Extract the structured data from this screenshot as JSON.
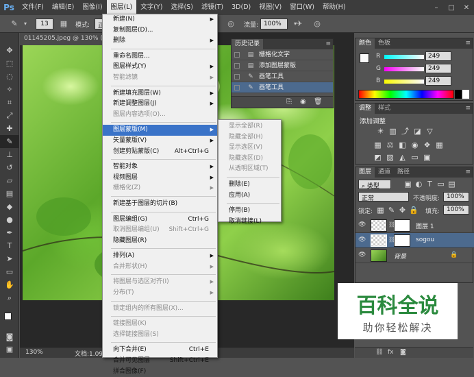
{
  "menubar": {
    "logo": "Ps",
    "items": [
      "文件(F)",
      "编辑(E)",
      "图像(I)",
      "图层(L)",
      "文字(Y)",
      "选择(S)",
      "滤镜(T)",
      "3D(D)",
      "视图(V)",
      "窗口(W)",
      "帮助(H)"
    ],
    "active_index": 3
  },
  "options_bar": {
    "brush_size": "13",
    "mode_label": "模式:",
    "mode_value": "正",
    "flow_label": "流量:",
    "flow_value": "100%"
  },
  "document": {
    "tab_title": "01145205.jpeg @ 130% (sog"
  },
  "status": {
    "zoom": "130%",
    "doc_info": "文档:1.09"
  },
  "layer_menu": {
    "items": [
      {
        "label": "新建(N)",
        "arrow": true
      },
      {
        "label": "复制图层(D)..."
      },
      {
        "label": "删除",
        "arrow": true
      },
      {
        "sep": true
      },
      {
        "label": "重命名图层..."
      },
      {
        "label": "图层样式(Y)",
        "arrow": true
      },
      {
        "label": "智能滤镜",
        "disabled": true,
        "arrow": true
      },
      {
        "sep": true
      },
      {
        "label": "新建填充图层(W)",
        "arrow": true
      },
      {
        "label": "新建调整图层(J)",
        "arrow": true
      },
      {
        "label": "图层内容选项(O)...",
        "disabled": true
      },
      {
        "sep": true
      },
      {
        "label": "图层蒙版(M)",
        "arrow": true,
        "highlighted": true
      },
      {
        "label": "矢量蒙版(V)",
        "arrow": true
      },
      {
        "label": "创建剪贴蒙版(C)",
        "shortcut": "Alt+Ctrl+G"
      },
      {
        "sep": true
      },
      {
        "label": "智能对象",
        "arrow": true
      },
      {
        "label": "视频图层",
        "arrow": true
      },
      {
        "label": "栅格化(Z)",
        "disabled": true,
        "arrow": true
      },
      {
        "sep": true
      },
      {
        "label": "新建基于图层的切片(B)"
      },
      {
        "sep": true
      },
      {
        "label": "图层编组(G)",
        "shortcut": "Ctrl+G"
      },
      {
        "label": "取消图层编组(U)",
        "shortcut": "Shift+Ctrl+G",
        "disabled": true
      },
      {
        "label": "隐藏图层(R)"
      },
      {
        "sep": true
      },
      {
        "label": "排列(A)",
        "arrow": true
      },
      {
        "label": "合并形状(H)",
        "disabled": true,
        "arrow": true
      },
      {
        "sep": true
      },
      {
        "label": "将图层与选区对齐(I)",
        "disabled": true,
        "arrow": true
      },
      {
        "label": "分布(T)",
        "disabled": true,
        "arrow": true
      },
      {
        "sep": true
      },
      {
        "label": "锁定组内的所有图层(X)...",
        "disabled": true
      },
      {
        "sep": true
      },
      {
        "label": "链接图层(K)",
        "disabled": true
      },
      {
        "label": "选择链接图层(S)",
        "disabled": true
      },
      {
        "sep": true
      },
      {
        "label": "向下合并(E)",
        "shortcut": "Ctrl+E"
      },
      {
        "label": "合并可见图层",
        "shortcut": "Shift+Ctrl+E"
      },
      {
        "label": "拼合图像(F)"
      }
    ]
  },
  "mask_submenu": {
    "items": [
      {
        "label": "显示全部(R)",
        "disabled": true
      },
      {
        "label": "隐藏全部(H)",
        "disabled": true
      },
      {
        "label": "显示选区(V)",
        "disabled": true
      },
      {
        "label": "隐藏选区(D)",
        "disabled": true
      },
      {
        "label": "从透明区域(T)",
        "disabled": true
      },
      {
        "sep": true
      },
      {
        "label": "删除(E)"
      },
      {
        "label": "应用(A)"
      },
      {
        "sep": true
      },
      {
        "label": "停用(B)"
      },
      {
        "label": "取消链接(L)"
      }
    ]
  },
  "history": {
    "tab": "历史记录",
    "rows": [
      {
        "label": "栅格化文字",
        "icon": "document-icon"
      },
      {
        "label": "添加图层蒙版",
        "icon": "document-icon"
      },
      {
        "label": "画笔工具",
        "icon": "brush-icon"
      },
      {
        "label": "画笔工具",
        "icon": "brush-icon",
        "selected": true
      }
    ]
  },
  "color_panel": {
    "tabs": [
      "颜色",
      "色板"
    ],
    "channels": [
      {
        "label": "R",
        "value": "249"
      },
      {
        "label": "G",
        "value": "249"
      },
      {
        "label": "B",
        "value": "249"
      }
    ]
  },
  "adjust_panel": {
    "tabs": [
      "调整",
      "样式"
    ],
    "title": "添加调整"
  },
  "layers_panel": {
    "tabs": [
      "图层",
      "通道",
      "路径"
    ],
    "filter": "类型",
    "blend_mode": "正常",
    "opacity_label": "不透明度:",
    "opacity_value": "100%",
    "lock_label": "锁定:",
    "fill_label": "填充:",
    "fill_value": "100%",
    "layers": [
      {
        "name": "图层 1"
      },
      {
        "name": "sogou",
        "selected": true
      },
      {
        "name": "背景"
      }
    ]
  },
  "watermark": {
    "title": "百科全说",
    "subtitle": "助你轻松解决"
  }
}
